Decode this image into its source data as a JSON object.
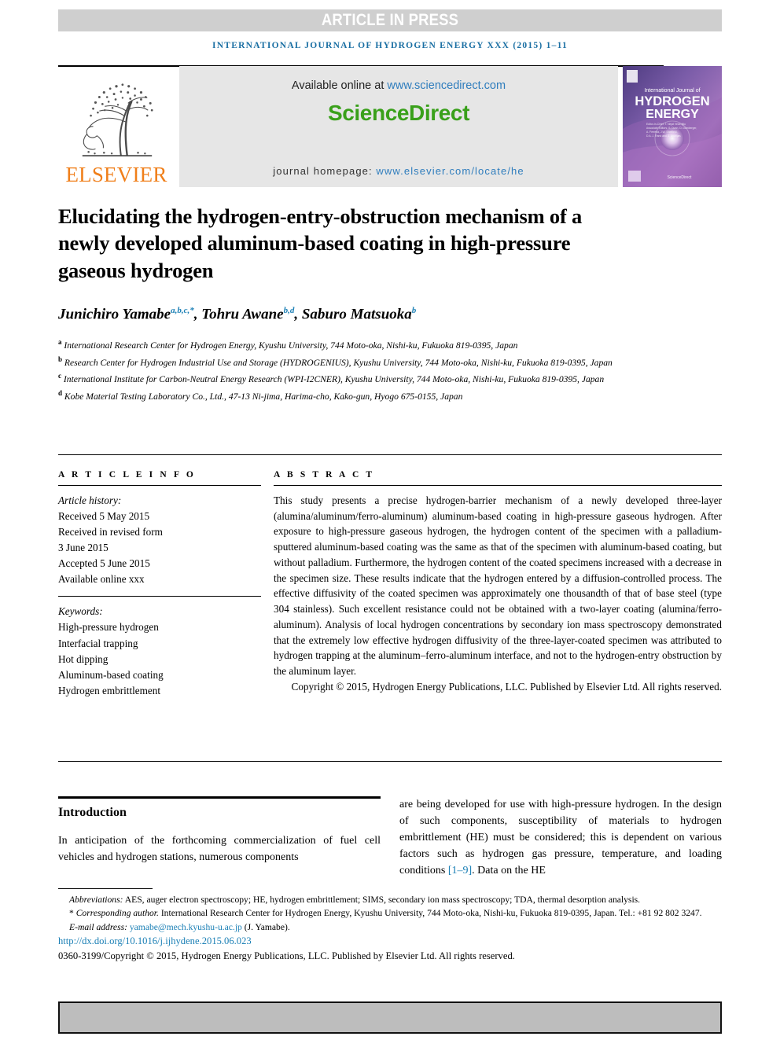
{
  "banner": {
    "article_in_press": "ARTICLE IN PRESS",
    "running_head": "INTERNATIONAL JOURNAL OF HYDROGEN ENERGY XXX (2015) 1–11"
  },
  "masthead": {
    "publisher_name": "ELSEVIER",
    "available_online_prefix": "Available online at ",
    "sciencedirect_url": "www.sciencedirect.com",
    "sciencedirect_wordmark": "ScienceDirect",
    "homepage_prefix": "journal homepage: ",
    "homepage_url": "www.elsevier.com/locate/he",
    "cover": {
      "line1": "International Journal of",
      "line2": "HYDROGEN",
      "line3": "ENERGY",
      "editor_block": "Editor-in-Chief: T. Nejat Veziroğlu\nAssociate Editors: S. Dunn, D.L. Damberger, A. Al-Kayiem, A.C. Ferreira, J.W. Sheffield, D.A. J. Rand and D. A. Andrijanovič",
      "footer_brand": "ScienceDirect"
    }
  },
  "article": {
    "title": "Elucidating the hydrogen-entry-obstruction mechanism of a newly developed aluminum-based coating in high-pressure gaseous hydrogen",
    "authors": [
      {
        "name": "Junichiro Yamabe",
        "marks": "a,b,c,*"
      },
      {
        "name": "Tohru Awane",
        "marks": "b,d"
      },
      {
        "name": "Saburo Matsuoka",
        "marks": "b"
      }
    ],
    "affiliations": [
      {
        "mark": "a",
        "text": "International Research Center for Hydrogen Energy, Kyushu University, 744 Moto-oka, Nishi-ku, Fukuoka 819-0395, Japan"
      },
      {
        "mark": "b",
        "text": "Research Center for Hydrogen Industrial Use and Storage (HYDROGENIUS), Kyushu University, 744 Moto-oka, Nishi-ku, Fukuoka 819-0395, Japan"
      },
      {
        "mark": "c",
        "text": "International Institute for Carbon-Neutral Energy Research (WPI-I2CNER), Kyushu University, 744 Moto-oka, Nishi-ku, Fukuoka 819-0395, Japan"
      },
      {
        "mark": "d",
        "text": "Kobe Material Testing Laboratory Co., Ltd., 47-13 Ni-jima, Harima-cho, Kako-gun, Hyogo 675-0155, Japan"
      }
    ]
  },
  "article_info": {
    "heading": "A R T I C L E  I N F O",
    "history_title": "Article history:",
    "history": [
      "Received 5 May 2015",
      "Received in revised form",
      "3 June 2015",
      "Accepted 5 June 2015",
      "Available online xxx"
    ],
    "keywords_title": "Keywords:",
    "keywords": [
      "High-pressure hydrogen",
      "Interfacial trapping",
      "Hot dipping",
      "Aluminum-based coating",
      "Hydrogen embrittlement"
    ]
  },
  "abstract": {
    "heading": "A B S T R A C T",
    "text": "This study presents a precise hydrogen-barrier mechanism of a newly developed three-layer (alumina/aluminum/ferro-aluminum) aluminum-based coating in high-pressure gaseous hydrogen. After exposure to high-pressure gaseous hydrogen, the hydrogen content of the specimen with a palladium-sputtered aluminum-based coating was the same as that of the specimen with aluminum-based coating, but without palladium. Furthermore, the hydrogen content of the coated specimens increased with a decrease in the specimen size. These results indicate that the hydrogen entered by a diffusion-controlled process. The effective diffusivity of the coated specimen was approximately one thousandth of that of base steel (type 304 stainless). Such excellent resistance could not be obtained with a two-layer coating (alumina/ferro-aluminum). Analysis of local hydrogen concentrations by secondary ion mass spectroscopy demonstrated that the extremely low effective hydrogen diffusivity of the three-layer-coated specimen was attributed to hydrogen trapping at the aluminum–ferro-aluminum interface, and not to the hydrogen-entry obstruction by the aluminum layer.",
    "copyright": "Copyright © 2015, Hydrogen Energy Publications, LLC. Published by Elsevier Ltd. All rights reserved."
  },
  "body": {
    "section_heading": "Introduction",
    "left_paragraph": "In anticipation of the forthcoming commercialization of fuel cell vehicles and hydrogen stations, numerous components",
    "right_paragraph_a": "are being developed for use with high-pressure hydrogen. In the design of such components, susceptibility of materials to hydrogen embrittlement (HE) must be considered; this is dependent on various factors such as hydrogen gas pressure, temperature, and loading conditions ",
    "right_reference": "[1–9]",
    "right_paragraph_b": ". Data on the HE"
  },
  "footnotes": {
    "abbreviations_label": "Abbreviations:",
    "abbreviations_text": " AES, auger electron spectroscopy; HE, hydrogen embrittlement; SIMS, secondary ion mass spectroscopy; TDA, thermal desorption analysis.",
    "corresponding_marker": "*",
    "corresponding_label": "Corresponding author.",
    "corresponding_text": " International Research Center for Hydrogen Energy, Kyushu University, 744 Moto-oka, Nishi-ku, Fukuoka 819-0395, Japan. Tel.: +81 92 802 3247.",
    "email_label": "E-mail address: ",
    "email": "yamabe@mech.kyushu-u.ac.jp",
    "email_suffix": " (J. Yamabe).",
    "doi": "http://dx.doi.org/10.1016/j.ijhydene.2015.06.023",
    "issn_copyright": "0360-3199/Copyright © 2015, Hydrogen Energy Publications, LLC. Published by Elsevier Ltd. All rights reserved."
  },
  "colors": {
    "journal_blue": "#1a6fa3",
    "link_blue": "#2f7dbd",
    "sciencedirect_green": "#39a01a",
    "elsevier_orange": "#f07f1a",
    "banner_gray": "#cfcfcf",
    "panel_gray": "#e6e6e6",
    "bottom_box_gray": "#bdbdbd"
  }
}
